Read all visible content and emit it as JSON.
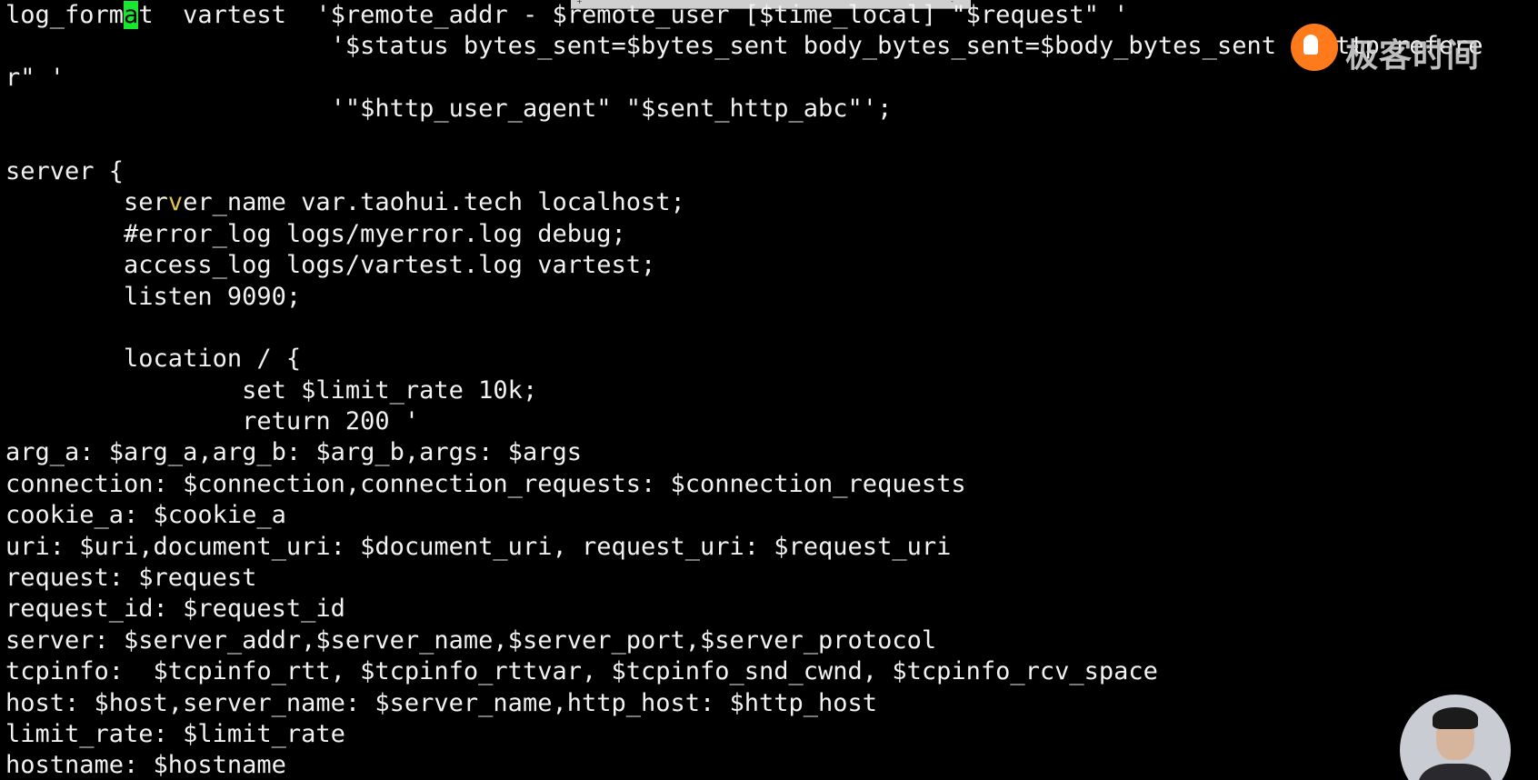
{
  "terminal": {
    "lines": [
      {
        "segments": [
          {
            "t": "log_form",
            "c": "text"
          },
          {
            "t": "a",
            "c": "cursor"
          },
          {
            "t": "t  vartest  '$remote_addr - $remote_user [$time_local] \"$request\" '",
            "c": "text"
          }
        ]
      },
      {
        "segments": [
          {
            "t": "                      '$status bytes_sent=$bytes_sent body_bytes_sent=$body_bytes_sent \"$http_refere",
            "c": "text"
          }
        ]
      },
      {
        "segments": [
          {
            "t": "r\" '",
            "c": "text"
          }
        ]
      },
      {
        "segments": [
          {
            "t": "                      '\"$http_user_agent\" \"$sent_http_abc\"';",
            "c": "text"
          }
        ]
      },
      {
        "segments": [
          {
            "t": "",
            "c": "text"
          }
        ]
      },
      {
        "segments": [
          {
            "t": "server {",
            "c": "text"
          }
        ]
      },
      {
        "segments": [
          {
            "t": "        ser",
            "c": "text"
          },
          {
            "t": "v",
            "c": "ibeam"
          },
          {
            "t": "er_name var.taohui.tech localhost;",
            "c": "text"
          }
        ]
      },
      {
        "segments": [
          {
            "t": "        #error_log logs/myerror.log debug;",
            "c": "text"
          }
        ]
      },
      {
        "segments": [
          {
            "t": "        access_log logs/vartest.log vartest;",
            "c": "text"
          }
        ]
      },
      {
        "segments": [
          {
            "t": "        listen 9090;",
            "c": "text"
          }
        ]
      },
      {
        "segments": [
          {
            "t": "",
            "c": "text"
          }
        ]
      },
      {
        "segments": [
          {
            "t": "        location / {",
            "c": "text"
          }
        ]
      },
      {
        "segments": [
          {
            "t": "                set $limit_rate 10k;",
            "c": "text"
          }
        ]
      },
      {
        "segments": [
          {
            "t": "                return 200 '",
            "c": "text"
          }
        ]
      },
      {
        "segments": [
          {
            "t": "arg_a: $arg_a,arg_b: $arg_b,args: $args",
            "c": "text"
          }
        ]
      },
      {
        "segments": [
          {
            "t": "connection: $connection,connection_requests: $connection_requests",
            "c": "text"
          }
        ]
      },
      {
        "segments": [
          {
            "t": "cookie_a: $cookie_a",
            "c": "text"
          }
        ]
      },
      {
        "segments": [
          {
            "t": "uri: $uri,document_uri: $document_uri, request_uri: $request_uri",
            "c": "text"
          }
        ]
      },
      {
        "segments": [
          {
            "t": "request: $request",
            "c": "text"
          }
        ]
      },
      {
        "segments": [
          {
            "t": "request_id: $request_id",
            "c": "text"
          }
        ]
      },
      {
        "segments": [
          {
            "t": "server: $server_addr,$server_name,$server_port,$server_protocol",
            "c": "text"
          }
        ]
      },
      {
        "segments": [
          {
            "t": "tcpinfo:  $tcpinfo_rtt, $tcpinfo_rttvar, $tcpinfo_snd_cwnd, $tcpinfo_rcv_space",
            "c": "text"
          }
        ]
      },
      {
        "segments": [
          {
            "t": "host: $host,server_name: $server_name,http_host: $http_host",
            "c": "text"
          }
        ]
      },
      {
        "segments": [
          {
            "t": "limit_rate: $limit_rate",
            "c": "text"
          }
        ]
      },
      {
        "segments": [
          {
            "t": "hostname: $hostname",
            "c": "text"
          }
        ]
      }
    ]
  },
  "watermark": {
    "brand_text": "极客时间",
    "icon": "geektime-logo-icon"
  },
  "overlay": {
    "presenter": "presenter-avatar"
  },
  "colors": {
    "background": "#000000",
    "text": "#f2f2f2",
    "cursor": "#19e62e",
    "brand": "#ff7a1a"
  }
}
